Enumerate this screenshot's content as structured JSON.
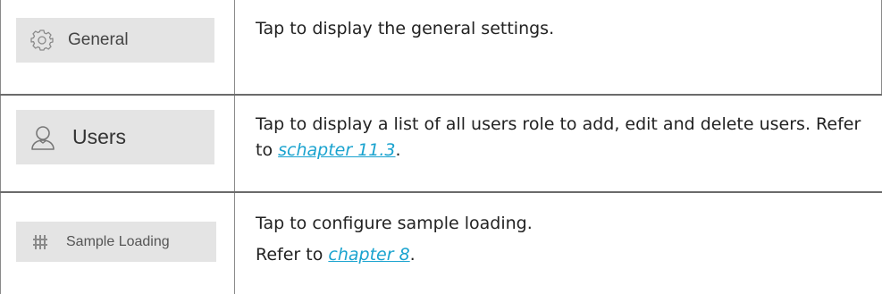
{
  "rows": [
    {
      "button_label": "General",
      "button_icon": "gear-icon",
      "description": "Tap to display the general settings."
    },
    {
      "button_label": "Users",
      "button_icon": "user-icon",
      "description_before": "Tap to display a list of all users role to add, edit and delete users. Refer to ",
      "link_text": "schapter 11.3",
      "description_after": "."
    },
    {
      "button_label": "Sample Loading",
      "button_icon": "sample-loading-icon",
      "description_line1": "Tap to configure sample loading.",
      "description_before": "Refer to ",
      "link_text": "chapter 8",
      "description_after": "."
    }
  ],
  "colors": {
    "button_bg": "#e4e4e4",
    "link": "#1aa3cf",
    "border": "#6b6b6b"
  }
}
